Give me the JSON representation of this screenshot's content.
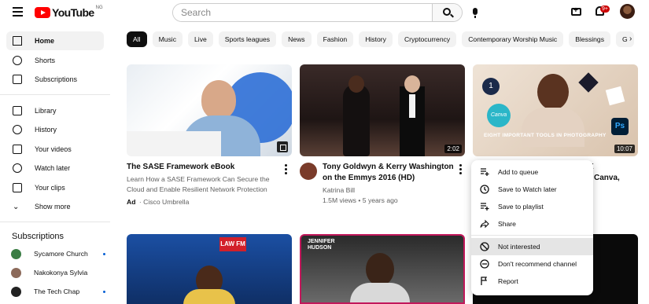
{
  "header": {
    "logo_text": "YouTube",
    "country_code": "NG",
    "search_placeholder": "Search",
    "notifications_badge": "9+"
  },
  "sidebar": {
    "main": [
      {
        "label": "Home",
        "icon": "home-icon",
        "active": true
      },
      {
        "label": "Shorts",
        "icon": "shorts-icon"
      },
      {
        "label": "Subscriptions",
        "icon": "subscriptions-icon"
      }
    ],
    "library": [
      {
        "label": "Library",
        "icon": "library-icon"
      },
      {
        "label": "History",
        "icon": "history-icon"
      },
      {
        "label": "Your videos",
        "icon": "your-videos-icon"
      },
      {
        "label": "Watch later",
        "icon": "watch-later-icon"
      },
      {
        "label": "Your clips",
        "icon": "clips-icon"
      },
      {
        "label": "Show more",
        "icon": "chevron-down-icon"
      }
    ],
    "subscriptions_heading": "Subscriptions",
    "subscriptions": [
      {
        "name": "Sycamore Church"
      },
      {
        "name": "Nakokonya Sylvia"
      },
      {
        "name": "The Tech Chap"
      }
    ]
  },
  "chips": [
    "All",
    "Music",
    "Live",
    "Sports leagues",
    "News",
    "Fashion",
    "History",
    "Cryptocurrency",
    "Contemporary Worship Music",
    "Blessings",
    "G"
  ],
  "videos": [
    {
      "title": "The SASE Framework eBook",
      "description": "Learn How a SASE Framework Can Secure the Cloud and Enable Resilient Network Protection",
      "ad_label": "Ad",
      "channel": "Cisco Umbrella"
    },
    {
      "title": "Tony Goldwyn & Kerry Washington on the Emmys 2016 (HD)",
      "channel": "Katrina Bill",
      "views": "1.5M views",
      "age": "5 years ago",
      "duration": "2:02"
    },
    {
      "title_partial_1": "E",
      "title_partial_2": "Canva,",
      "thumbnail_text": "EIGHT IMPORTANT TOOLS IN PHOTOGRAPHY",
      "duration": "10:07"
    },
    {
      "thumbnail_text": "LAW FM"
    },
    {
      "thumbnail_text": "JENNIFER HUDSON"
    }
  ],
  "context_menu": {
    "items": [
      {
        "label": "Add to queue",
        "icon": "add-to-queue-icon"
      },
      {
        "label": "Save to Watch later",
        "icon": "clock-icon"
      },
      {
        "label": "Save to playlist",
        "icon": "playlist-add-icon"
      },
      {
        "label": "Share",
        "icon": "share-icon"
      }
    ],
    "items2": [
      {
        "label": "Not interested",
        "icon": "not-interested-icon",
        "hover": true
      },
      {
        "label": "Don't recommend channel",
        "icon": "remove-circle-icon"
      },
      {
        "label": "Report",
        "icon": "flag-icon"
      }
    ]
  }
}
